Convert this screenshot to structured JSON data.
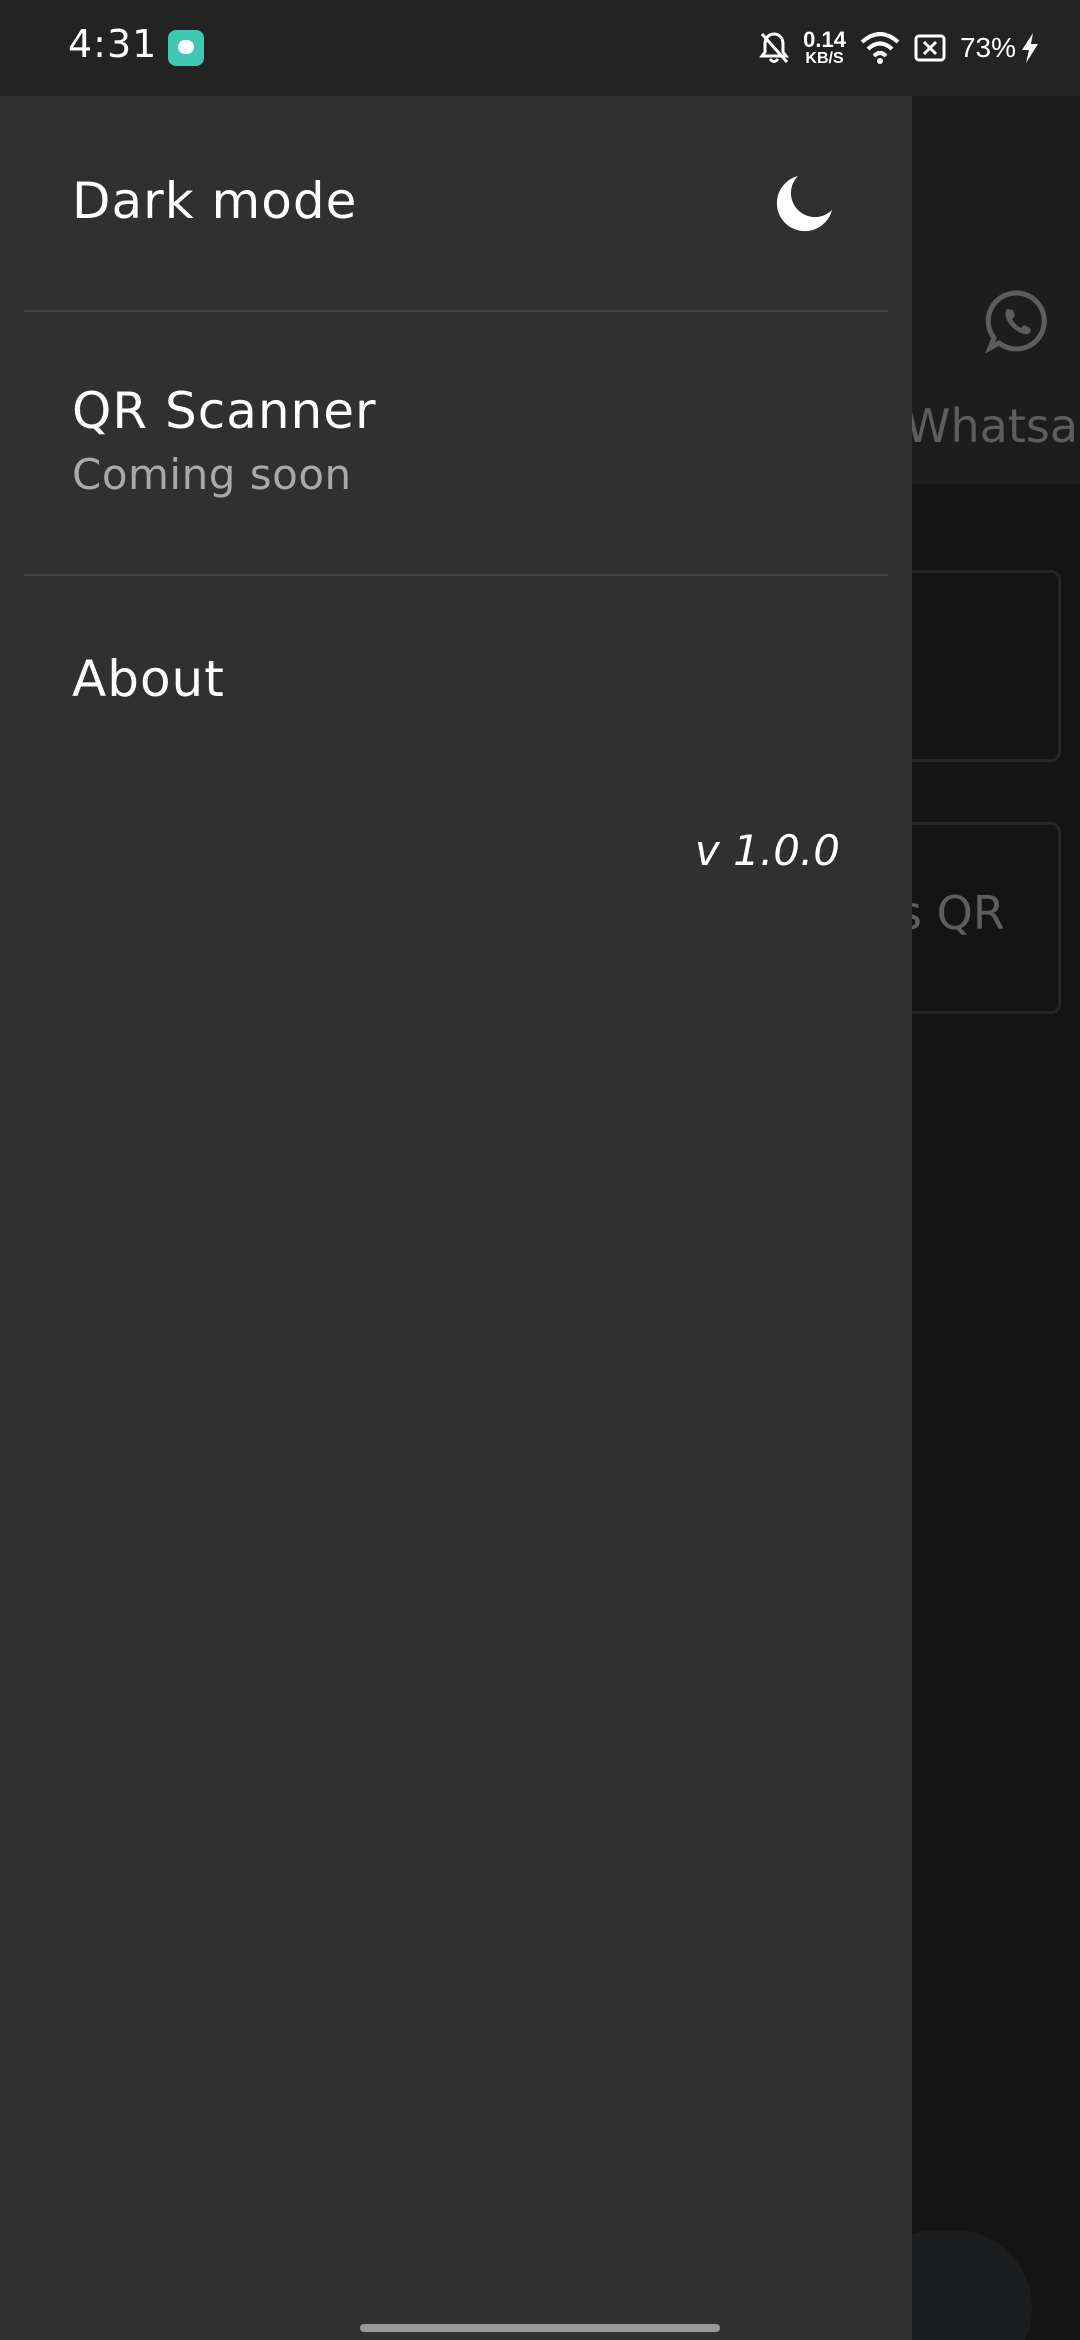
{
  "status_bar": {
    "time": "4:31",
    "net_speed_value": "0.14",
    "net_speed_unit": "KB/S",
    "battery": "73%"
  },
  "background_page": {
    "whatsapp_label": "Whatsa",
    "card_label": "s QR"
  },
  "drawer": {
    "dark_mode_label": "Dark mode",
    "qr_scanner_label": "QR Scanner",
    "qr_scanner_subtitle": "Coming soon",
    "about_label": "About",
    "version": "v 1.0.0"
  },
  "icons": {
    "status_app": "screen-recorder-icon",
    "notifications": "bell-off-icon",
    "wifi": "wifi-icon",
    "sim": "no-sim-icon",
    "charging": "bolt-icon",
    "dark_mode": "moon-icon",
    "whatsapp": "whatsapp-icon"
  },
  "colors": {
    "drawer_background": "#303030",
    "screen_background": "#1e1e1e",
    "status_app_icon": "#3fc7b1"
  }
}
